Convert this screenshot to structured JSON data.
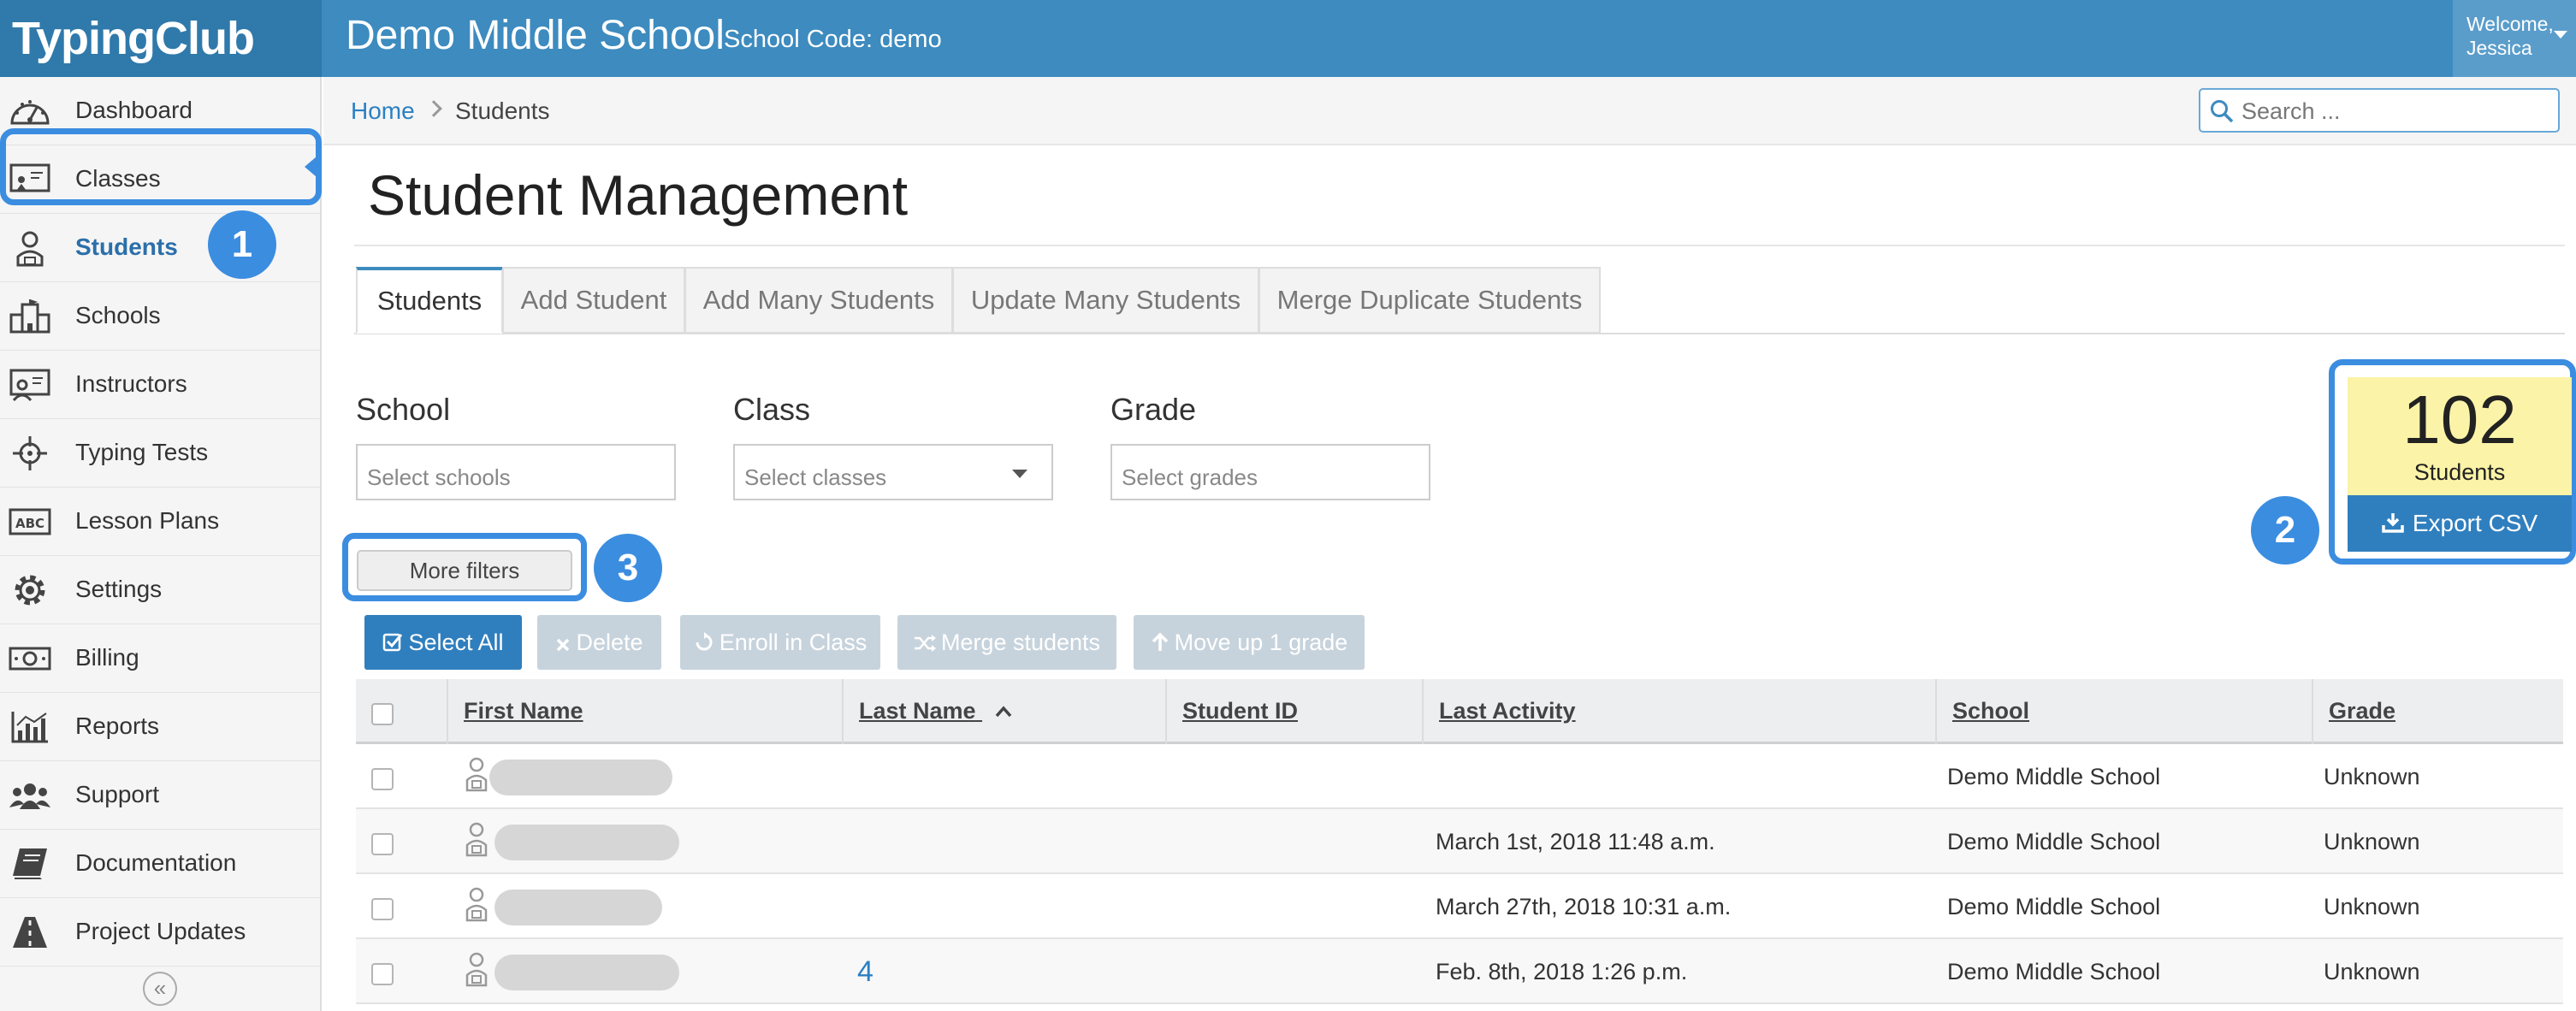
{
  "header": {
    "logo": "TypingClub",
    "school_name": "Demo Middle School",
    "school_code": "School Code: demo",
    "welcome_line1": "Welcome,",
    "welcome_line2": "Jessica"
  },
  "sidebar": {
    "items": [
      {
        "label": "Dashboard",
        "icon": "dashboard-icon"
      },
      {
        "label": "Classes",
        "icon": "classroom-icon"
      },
      {
        "label": "Students",
        "icon": "student-icon",
        "active": true
      },
      {
        "label": "Schools",
        "icon": "school-building-icon"
      },
      {
        "label": "Instructors",
        "icon": "instructor-icon"
      },
      {
        "label": "Typing Tests",
        "icon": "typing-test-icon"
      },
      {
        "label": "Lesson Plans",
        "icon": "abc-icon"
      },
      {
        "label": "Settings",
        "icon": "gear-icon"
      },
      {
        "label": "Billing",
        "icon": "money-icon"
      },
      {
        "label": "Reports",
        "icon": "chart-icon"
      },
      {
        "label": "Support",
        "icon": "group-icon"
      },
      {
        "label": "Documentation",
        "icon": "book-icon"
      },
      {
        "label": "Project Updates",
        "icon": "road-icon"
      }
    ],
    "collapse_glyph": "«"
  },
  "markers": [
    "1",
    "2",
    "3"
  ],
  "breadcrumb": {
    "home": "Home",
    "current": "Students"
  },
  "search": {
    "placeholder": "Search ..."
  },
  "page_title": "Student Management",
  "tabs": [
    "Students",
    "Add Student",
    "Add Many Students",
    "Update Many Students",
    "Merge Duplicate Students"
  ],
  "filters": {
    "school": {
      "label": "School",
      "placeholder": "Select schools"
    },
    "class": {
      "label": "Class",
      "placeholder": "Select classes"
    },
    "grade": {
      "label": "Grade",
      "placeholder": "Select grades"
    },
    "more_filters": "More filters"
  },
  "stats": {
    "count": "102",
    "label": "Students",
    "export": "Export CSV"
  },
  "actions": {
    "select_all": "Select All",
    "delete": "Delete",
    "enroll": "Enroll in Class",
    "merge": "Merge students",
    "move_up": "Move up 1 grade"
  },
  "table": {
    "headers": [
      "First Name",
      "Last Name",
      "Student ID",
      "Last Activity",
      "School",
      "Grade"
    ],
    "rows": [
      {
        "last_name": "",
        "student_id": "",
        "last_activity": "",
        "school": "Demo Middle School",
        "grade": "Unknown"
      },
      {
        "last_name": "",
        "student_id": "",
        "last_activity": "March 1st, 2018 11:48 a.m.",
        "school": "Demo Middle School",
        "grade": "Unknown"
      },
      {
        "last_name": "",
        "student_id": "",
        "last_activity": "March 27th, 2018 10:31 a.m.",
        "school": "Demo Middle School",
        "grade": "Unknown"
      },
      {
        "last_name": "4",
        "student_id": "",
        "last_activity": "Feb. 8th, 2018 1:26 p.m.",
        "school": "Demo Middle School",
        "grade": "Unknown"
      }
    ]
  },
  "colors": {
    "topbar": "#3d8bbf",
    "primary_button": "#2f7fbf",
    "callout": "#3b8de0",
    "stats_bg": "#fbf3a7",
    "link": "#2b80c3"
  }
}
